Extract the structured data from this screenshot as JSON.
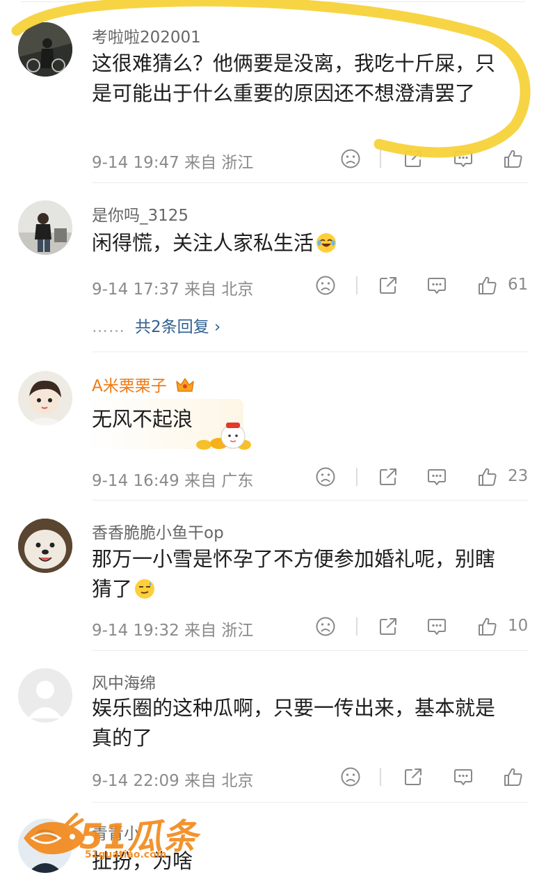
{
  "comments": [
    {
      "username": "考啦啦202001",
      "text": "这很难猜么？他俩要是没离，我吃十斤屎，只是可能出于什么重要的原因还不想澄清罢了",
      "meta": "9-14 19:47 来自 浙江",
      "likes": ""
    },
    {
      "username": "是你吗_3125",
      "text": "闲得慌，关注人家私生活",
      "meta": "9-14 17:37 来自 北京",
      "likes": "61",
      "replies": {
        "dots": "……",
        "label": "共2条回复 ›"
      }
    },
    {
      "username": "A米栗栗子",
      "text": "无风不起浪",
      "meta": "9-14 16:49 来自 广东",
      "likes": "23"
    },
    {
      "username": "香香脆脆小鱼干op",
      "text": "那万一小雪是怀孕了不方便参加婚礼呢，别瞎猜了",
      "meta": "9-14 19:32 来自 浙江",
      "likes": "10"
    },
    {
      "username": "风中海绵",
      "text": "娱乐圈的这种瓜啊，只要一传出来，基本就是真的了",
      "meta": "9-14 22:09 来自 北京",
      "likes": ""
    },
    {
      "username": "青青小",
      "text": "扯扮，为啥",
      "meta": "",
      "likes": ""
    }
  ],
  "watermark": {
    "brand": "51瓜条",
    "url": "51guatiao.com"
  },
  "colors": {
    "vip_name": "#f07a14",
    "reply_link": "#2f5f8f",
    "highlight": "#f7d23a",
    "brand": "#f28a1e"
  },
  "icons": [
    "dislike-icon",
    "share-icon",
    "comment-icon",
    "like-icon",
    "crown-badge-icon"
  ]
}
